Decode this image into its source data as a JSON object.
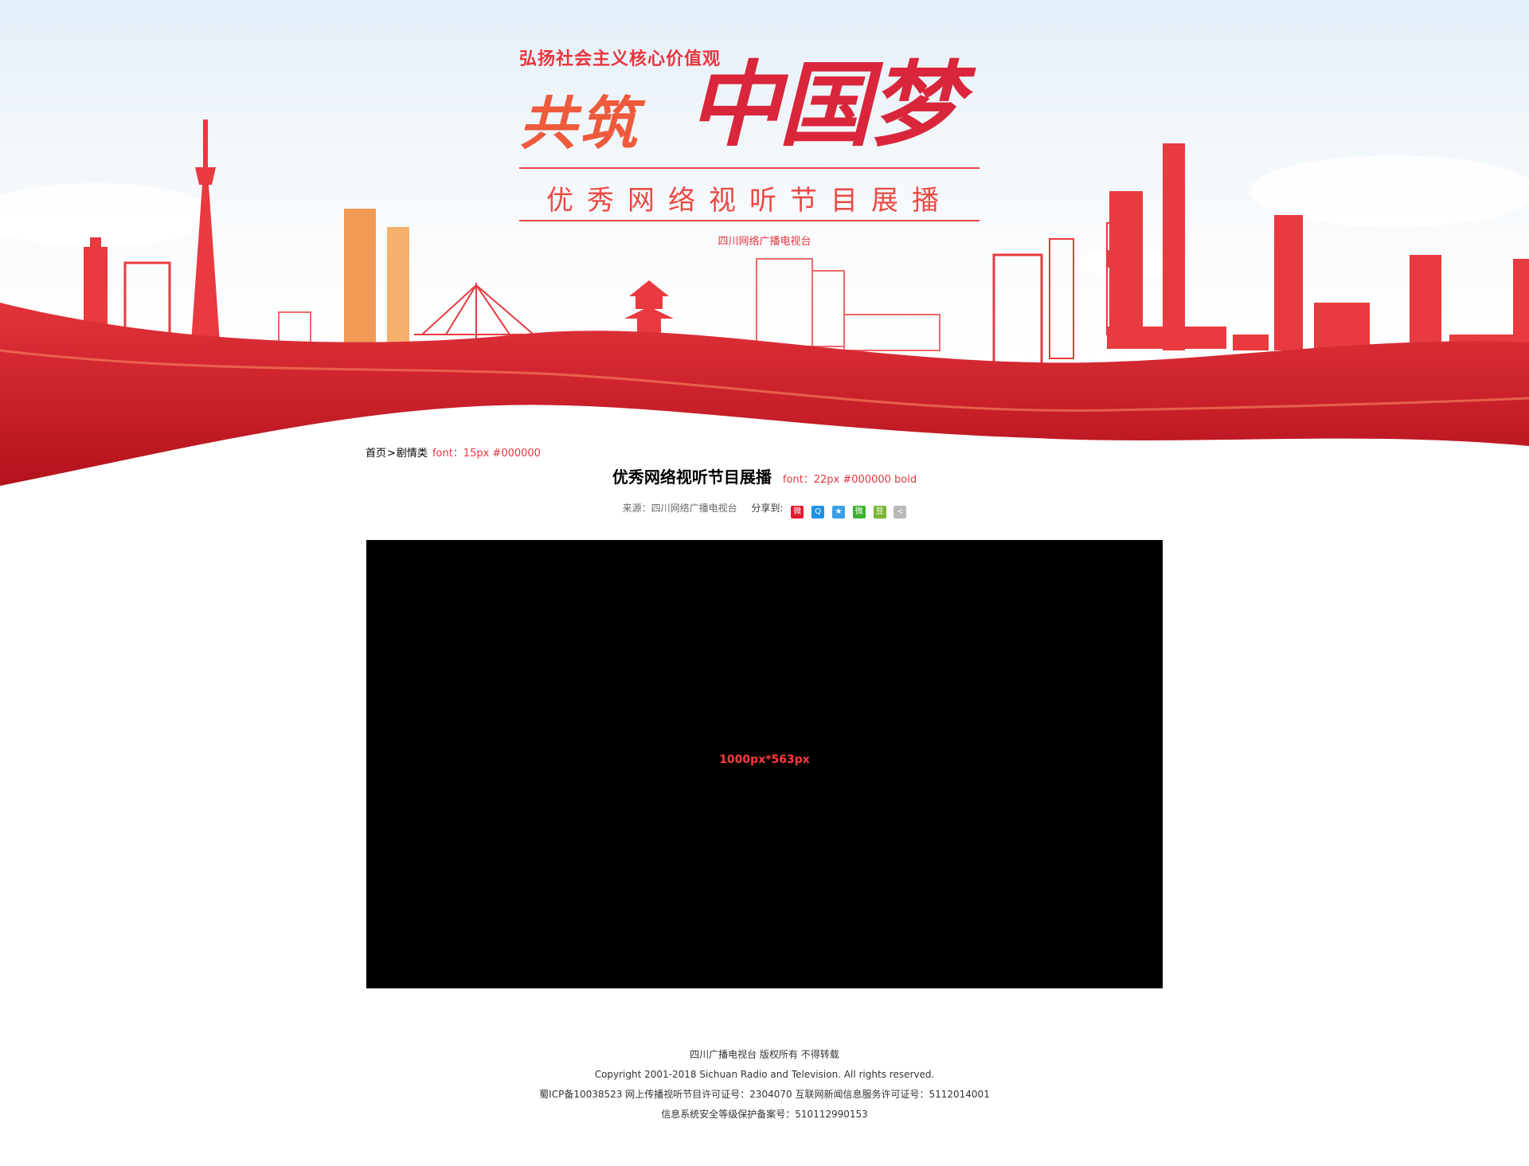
{
  "banner": {
    "slogan": "弘扬社会主义核心价值观",
    "title_part1": "共筑",
    "title_part2": "中国梦",
    "subtitle": "优秀网络视听节目展播",
    "organizer": "四川网络广播电视台"
  },
  "breadcrumb": {
    "home": "首页",
    "separator": ">",
    "category": "剧情类",
    "note": "font：15px #000000"
  },
  "article": {
    "title": "优秀网络视听节目展播",
    "title_note": "font：22px #000000 bold",
    "source": "来源：四川网络广播电视台",
    "share_label": "分享到:",
    "share_icons": [
      "weibo-icon",
      "qq-icon",
      "qzone-icon",
      "wechat-icon",
      "douban-icon",
      "more-share-icon"
    ]
  },
  "video": {
    "size_label": "1000px*563px"
  },
  "footer": {
    "line1": "四川广播电视台 版权所有 不得转载",
    "line2": "Copyright 2001-2018 Sichuan Radio and Television. All rights reserved.",
    "line3": "蜀ICP备10038523 网上传播视听节目许可证号：2304070 互联网新闻信息服务许可证号：5112014001",
    "line4": "信息系统安全等级保护备案号：510112990153"
  },
  "colors": {
    "accent": "#e8363e",
    "ribbon": "#d4202a",
    "video_bg": "#000000"
  }
}
